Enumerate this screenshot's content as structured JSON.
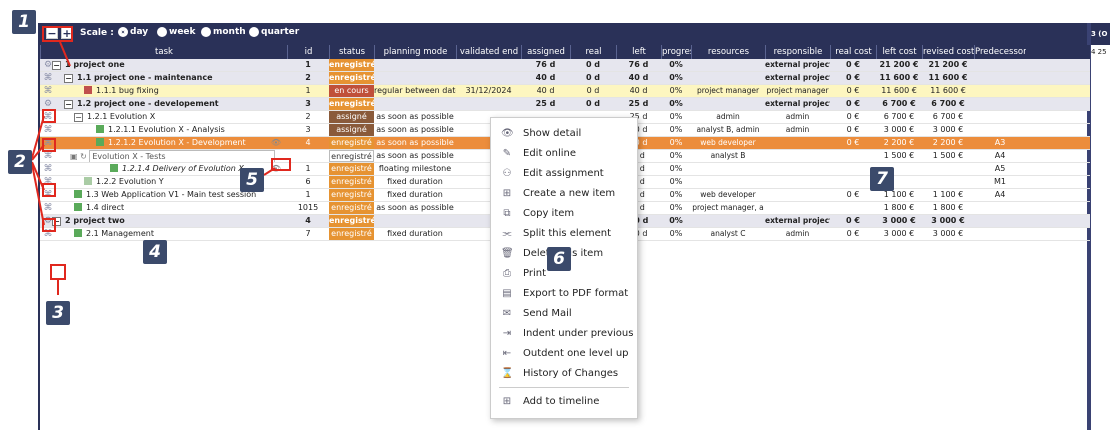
{
  "toolbar": {
    "collapse_icon": "minus-square-icon",
    "expand_icon": "plus-square-icon",
    "scale_label": "Scale :",
    "scale_options": [
      "day",
      "week",
      "month",
      "quarter"
    ],
    "scale_selected": "day",
    "corner_text": "3 (O",
    "corner_sub": "4 25"
  },
  "columns": [
    "task",
    "id",
    "status",
    "planning mode",
    "validated end",
    "assigned",
    "real",
    "left",
    "progress",
    "resources",
    "responsible",
    "real cost",
    "left cost",
    "revised cost",
    "Predecessors"
  ],
  "rows": [
    {
      "name": "1 project one",
      "id": "1",
      "status": "enregistré",
      "planning": "",
      "validated_end": "",
      "assigned": "76 d",
      "real": "0 d",
      "left": "76 d",
      "progress": "0%",
      "resources": "",
      "responsible": "external project l",
      "real_cost": "0 €",
      "left_cost": "21 200 €",
      "revised_cost": "21 200 €",
      "pred": ""
    },
    {
      "name": "1.1 project one - maintenance",
      "id": "2",
      "status": "enregistré",
      "planning": "",
      "validated_end": "",
      "assigned": "40 d",
      "real": "0 d",
      "left": "40 d",
      "progress": "0%",
      "resources": "",
      "responsible": "external project l",
      "real_cost": "0 €",
      "left_cost": "11 600 €",
      "revised_cost": "11 600 €",
      "pred": ""
    },
    {
      "name": "1.1.1 bug fixing",
      "id": "1",
      "status": "en cours",
      "planning": "regular between date",
      "validated_end": "31/12/2024",
      "assigned": "40 d",
      "real": "0 d",
      "left": "40 d",
      "progress": "0%",
      "resources": "project manager",
      "responsible": "project manager",
      "real_cost": "0 €",
      "left_cost": "11 600 €",
      "revised_cost": "11 600 €",
      "pred": ""
    },
    {
      "name": "1.2 project one - developement",
      "id": "3",
      "status": "enregistré",
      "planning": "",
      "validated_end": "",
      "assigned": "25 d",
      "real": "0 d",
      "left": "25 d",
      "progress": "0%",
      "resources": "",
      "responsible": "external project l",
      "real_cost": "0 €",
      "left_cost": "6 700 €",
      "revised_cost": "6 700 €",
      "pred": ""
    },
    {
      "name": "1.2.1 Evolution X",
      "id": "2",
      "status": "assigné",
      "planning": "as soon as possible",
      "validated_end": "",
      "assigned": "",
      "real": "",
      "left": "25 d",
      "progress": "0%",
      "resources": "admin",
      "responsible": "admin",
      "real_cost": "0 €",
      "left_cost": "6 700 €",
      "revised_cost": "6 700 €",
      "pred": ""
    },
    {
      "name": "1.2.1.1 Evolution X - Analysis",
      "id": "3",
      "status": "assigné",
      "planning": "as soon as possible",
      "validated_end": "",
      "assigned": "",
      "real": "",
      "left": "10 d",
      "progress": "0%",
      "resources": "analyst B, admin",
      "responsible": "admin",
      "real_cost": "0 €",
      "left_cost": "3 000 €",
      "revised_cost": "3 000 €",
      "pred": ""
    },
    {
      "name": "1.2.1.2 Evolution X - Development",
      "id": "4",
      "status": "enregistré",
      "planning": "as soon as possible",
      "validated_end": "",
      "assigned": "",
      "real": "",
      "left": "10 d",
      "progress": "0%",
      "resources": "web developer",
      "responsible": "",
      "real_cost": "0 €",
      "left_cost": "2 200 €",
      "revised_cost": "2 200 €",
      "pred": "A3"
    },
    {
      "name": "Evolution X - Tests",
      "id": "",
      "status": "enregistré",
      "planning": "as soon as possible",
      "validated_end": "",
      "assigned": "",
      "real": "",
      "left": "5 d",
      "progress": "0%",
      "resources": "analyst B",
      "responsible": "",
      "real_cost": "",
      "left_cost": "1 500 €",
      "revised_cost": "1 500 €",
      "pred": "A4"
    },
    {
      "name": "1.2.1.4 Delivery of Evolution X",
      "id": "1",
      "status": "enregistré",
      "planning": "floating milestone",
      "validated_end": "",
      "assigned": "",
      "real": "",
      "left": "0 d",
      "progress": "0%",
      "resources": "",
      "responsible": "",
      "real_cost": "",
      "left_cost": "",
      "revised_cost": "",
      "pred": "A5"
    },
    {
      "name": "1.2.2 Evolution Y",
      "id": "6",
      "status": "enregistré",
      "planning": "fixed duration",
      "validated_end": "",
      "assigned": "",
      "real": "",
      "left": "0 d",
      "progress": "0%",
      "resources": "",
      "responsible": "",
      "real_cost": "",
      "left_cost": "",
      "revised_cost": "",
      "pred": "M1"
    },
    {
      "name": "1.3 Web Application V1 - Main test session",
      "id": "1",
      "status": "enregistré",
      "planning": "fixed duration",
      "validated_end": "",
      "assigned": "",
      "real": "",
      "left": "5 d",
      "progress": "0%",
      "resources": "web developer",
      "responsible": "",
      "real_cost": "0 €",
      "left_cost": "1 100 €",
      "revised_cost": "1 100 €",
      "pred": "A4"
    },
    {
      "name": "1.4 direct",
      "id": "1015",
      "status": "enregistré",
      "planning": "as soon as possible",
      "validated_end": "",
      "assigned": "",
      "real": "",
      "left": "6 d",
      "progress": "0%",
      "resources": "project manager, a",
      "responsible": "",
      "real_cost": "",
      "left_cost": "1 800 €",
      "revised_cost": "1 800 €",
      "pred": ""
    },
    {
      "name": "2 project two",
      "id": "4",
      "status": "enregistré",
      "planning": "",
      "validated_end": "",
      "assigned": "",
      "real": "",
      "left": "10 d",
      "progress": "0%",
      "resources": "",
      "responsible": "external project l",
      "real_cost": "0 €",
      "left_cost": "3 000 €",
      "revised_cost": "3 000 €",
      "pred": ""
    },
    {
      "name": "2.1 Management",
      "id": "7",
      "status": "enregistré",
      "planning": "fixed duration",
      "validated_end": "",
      "assigned": "",
      "real": "",
      "left": "10 d",
      "progress": "0%",
      "resources": "analyst C",
      "responsible": "admin",
      "real_cost": "0 €",
      "left_cost": "3 000 €",
      "revised_cost": "3 000 €",
      "pred": ""
    }
  ],
  "context_menu": [
    {
      "label": "Show detail",
      "icon": "eye-icon"
    },
    {
      "label": "Edit online",
      "icon": "pencil-icon"
    },
    {
      "label": "Edit assignment",
      "icon": "assign-icon"
    },
    {
      "label": "Create a new item",
      "icon": "plus-icon"
    },
    {
      "label": "Copy item",
      "icon": "copy-icon"
    },
    {
      "label": "Split this element",
      "icon": "split-icon"
    },
    {
      "label": "Delete this item",
      "icon": "trash-icon"
    },
    {
      "label": "Print",
      "icon": "print-icon"
    },
    {
      "label": "Export to PDF format",
      "icon": "pdf-icon"
    },
    {
      "label": "Send Mail",
      "icon": "mail-icon"
    },
    {
      "label": "Indent under previous",
      "icon": "indent-icon"
    },
    {
      "label": "Outdent one level up",
      "icon": "outdent-icon"
    },
    {
      "label": "History of Changes",
      "icon": "hourglass-icon"
    },
    {
      "label": "Add to timeline",
      "icon": "plus-icon"
    }
  ],
  "badges": [
    "1",
    "2",
    "3",
    "4",
    "5",
    "6",
    "7"
  ],
  "colors": {
    "header": "#2a3158",
    "enregistre": "#e69332",
    "en_cours": "#c0503a",
    "assigne": "#8a5a3a",
    "highlight_orange": "#ec8d3c",
    "annotation_red": "#e0281e",
    "badge": "#3b4a6b"
  }
}
